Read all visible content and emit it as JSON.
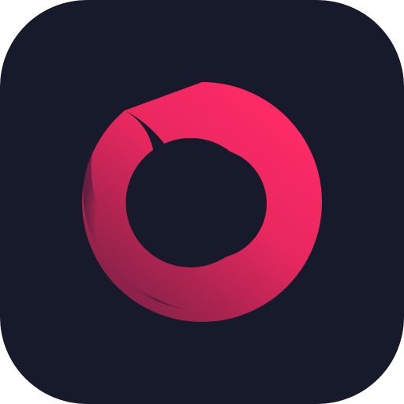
{
  "app_icon": {
    "colors": {
      "background": "#161a2b",
      "accent_top": "#ff2a66",
      "accent_mid": "#e8285f",
      "accent_bottom": "#8a2248",
      "accent_shadow": "#2a1a33"
    },
    "glyph": "ring-logo-icon"
  }
}
